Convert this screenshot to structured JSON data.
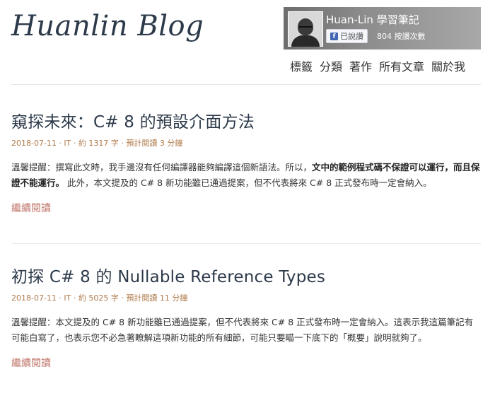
{
  "blog": {
    "title": "Huanlin Blog"
  },
  "fb_widget": {
    "page_name": "Huan-Lin 學習筆記",
    "like_label": "已說讚",
    "like_count": "804 按讚次數"
  },
  "nav": {
    "items": [
      "標籤",
      "分類",
      "著作",
      "所有文章",
      "關於我"
    ]
  },
  "posts": [
    {
      "title": "窺探未來：C# 8 的預設介面方法",
      "meta": "2018-07-11 · IT · 約 1317 字 · 預計閱讀 3 分鐘",
      "body_plain_1": "溫馨提醒：撰寫此文時，我手邊沒有任何編譯器能夠編譯這個新語法。所以，",
      "body_bold": "文中的範例程式碼不保證可以運行，而且保證不能運行。",
      "body_plain_2": " 此外，本文提及的 C# 8 新功能雖已通過提案，但不代表將來 C# 8 正式發布時一定會納入。",
      "read_more": "繼續閱讀"
    },
    {
      "title": "初探 C# 8 的 Nullable Reference Types",
      "meta": "2018-07-11 · IT · 約 5025 字 · 預計閱讀 11 分鐘",
      "body": "溫馨提醒：本文提及的 C# 8 新功能雖已通過提案，但不代表將來 C# 8 正式發布時一定會納入。這表示我這篇筆記有可能白寫了，也表示您不必急著瞭解這項新功能的所有細節，可能只要瞄一下底下的「概要」說明就夠了。",
      "read_more": "繼續閱讀"
    }
  ]
}
